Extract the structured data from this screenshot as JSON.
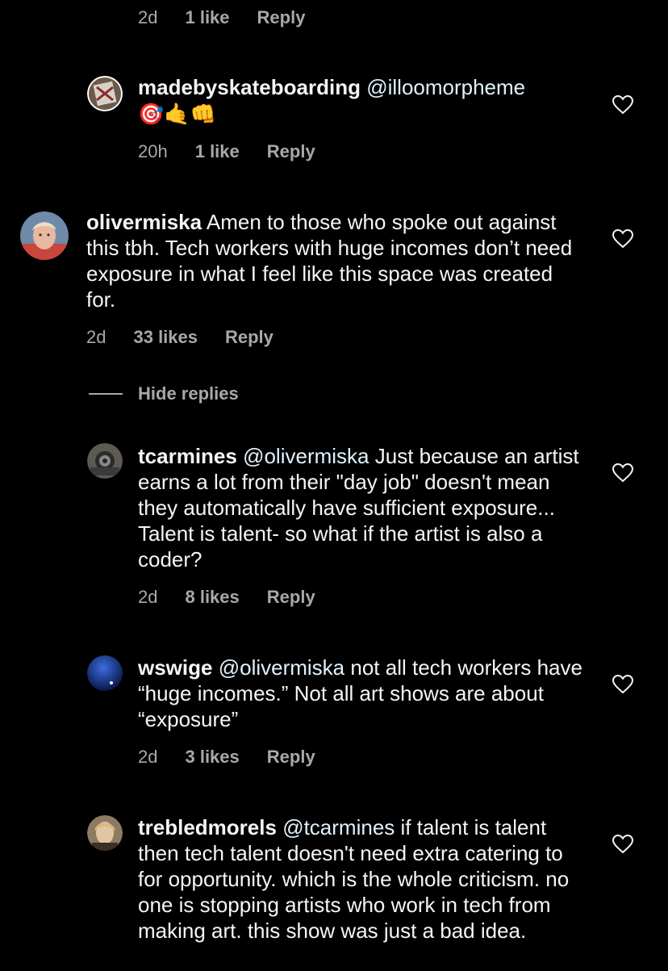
{
  "top_meta": {
    "time": "2d",
    "likes": "1 like",
    "reply": "Reply"
  },
  "comments": [
    {
      "username": "madebyskateboarding",
      "mention": "@illoomorpheme",
      "text": "",
      "emoji": "🎯🤙👊",
      "time": "20h",
      "likes": "1 like",
      "reply": "Reply"
    },
    {
      "username": "olivermiska",
      "mention": "",
      "text": "Amen to those who spoke out against this tbh. Tech workers with huge incomes don’t need exposure in what I feel like this space was created for.",
      "time": "2d",
      "likes": "33 likes",
      "reply": "Reply"
    },
    {
      "username": "tcarmines",
      "mention": "@olivermiska",
      "text": "Just because an artist earns a lot from their \"day job\" doesn't mean they automatically have sufficient exposure... Talent is talent- so what if the artist is also a coder?",
      "time": "2d",
      "likes": "8 likes",
      "reply": "Reply"
    },
    {
      "username": "wswige",
      "mention": "@olivermiska",
      "text": "not all tech workers have “huge incomes.” Not all art shows are about “exposure”",
      "time": "2d",
      "likes": "3 likes",
      "reply": "Reply"
    },
    {
      "username": "trebledmorels",
      "mention": "@tcarmines",
      "text": "if talent is talent then tech talent doesn't need extra catering to for opportunity. which is the whole criticism. no one is stopping artists who work in tech from making art. this show was just a bad idea.",
      "time": "",
      "likes": "",
      "reply": ""
    }
  ],
  "hide_replies": "Hide replies",
  "colors": {
    "background": "#000000",
    "text": "#f5f5f5",
    "secondary": "#a8a8a8",
    "mention": "#e0f1ff"
  }
}
